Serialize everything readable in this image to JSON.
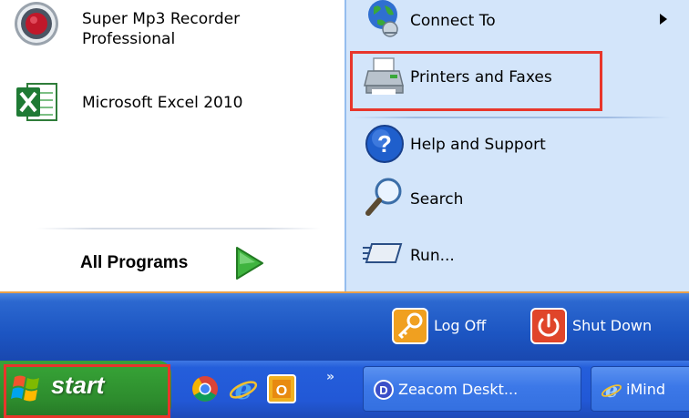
{
  "start_menu": {
    "left_programs": [
      {
        "label_line1": "Super Mp3 Recorder",
        "label_line2": "Professional",
        "icon": "recorder-icon"
      },
      {
        "label": "Microsoft Excel 2010",
        "icon": "excel-icon"
      }
    ],
    "all_programs_label": "All Programs",
    "right_items": {
      "connect_to": "Connect To",
      "printers_and_faxes": "Printers and Faxes",
      "help_and_support": "Help and Support",
      "search": "Search",
      "run": "Run..."
    },
    "log_off_label": "Log Off",
    "shut_down_label": "Shut Down"
  },
  "taskbar": {
    "start_label": "start",
    "quick_launch_icons": [
      "chrome-icon",
      "internet-explorer-icon",
      "outlook-icon"
    ],
    "overflow_glyph": "»",
    "tasks": [
      {
        "label": "Zeacom Deskt...",
        "icon": "zeacom-icon"
      },
      {
        "label": "iMind",
        "icon": "internet-explorer-icon"
      }
    ]
  },
  "colors": {
    "highlight": "#e8362b",
    "start_green": "#2d8b2d",
    "taskbar_blue": "#245edb",
    "right_pane": "#d3e5fa"
  }
}
